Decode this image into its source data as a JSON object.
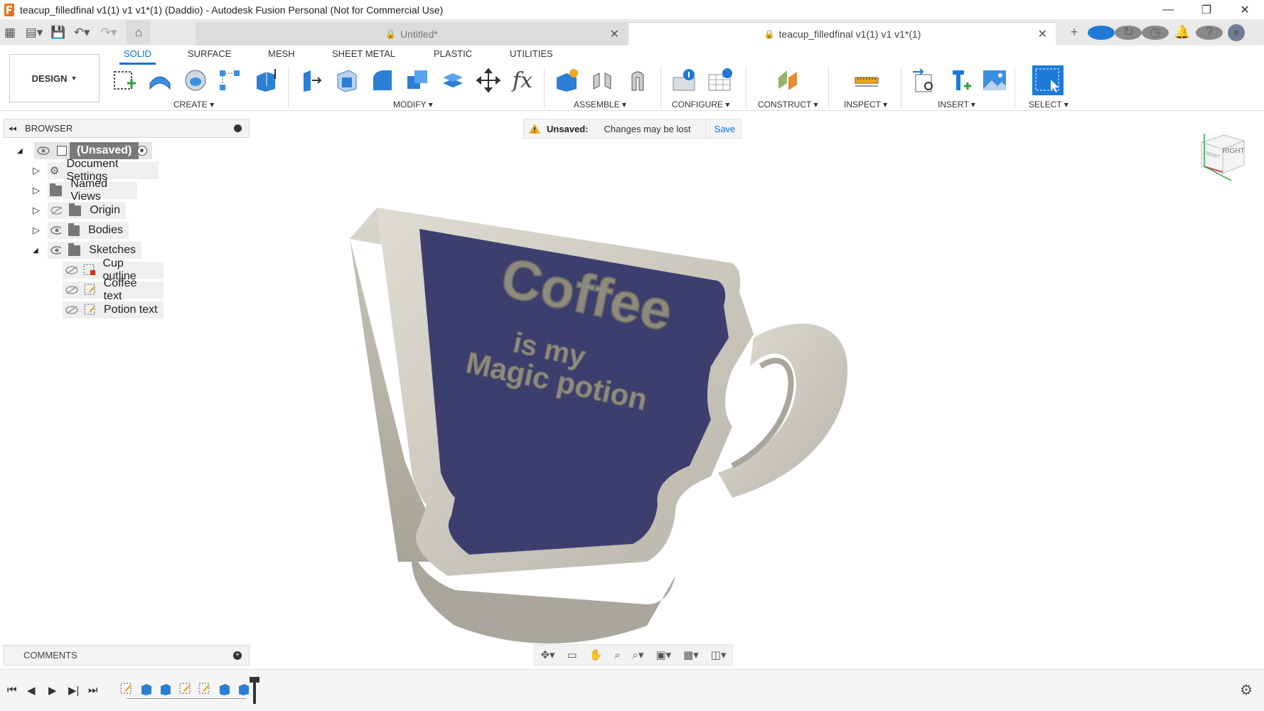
{
  "window": {
    "title": "teacup_filledfinal v1(1) v1 v1*(1) (Daddio) - Autodesk Fusion Personal (Not for Commercial Use)",
    "min": "—",
    "max": "❐",
    "close": "✕"
  },
  "tabs": {
    "untitled": "Untitled*",
    "active": "teacup_filledfinal v1(1) v1 v1*(1)",
    "close": "✕",
    "new_tab": "+"
  },
  "toolbar": {
    "workspace": "DESIGN",
    "workspace_tabs": [
      "SOLID",
      "SURFACE",
      "MESH",
      "SHEET METAL",
      "PLASTIC",
      "UTILITIES"
    ],
    "groups": [
      "CREATE",
      "MODIFY",
      "ASSEMBLE",
      "CONFIGURE",
      "CONSTRUCT",
      "INSPECT",
      "INSERT",
      "SELECT"
    ]
  },
  "browser": {
    "title": "BROWSER",
    "root": "(Unsaved)",
    "items": [
      "Document Settings",
      "Named Views",
      "Origin",
      "Bodies",
      "Sketches"
    ],
    "sketches": [
      "Cup outline",
      "Coffee text",
      "Potion text"
    ]
  },
  "banner": {
    "label": "Unsaved:",
    "message": "Changes may be lost",
    "save": "Save"
  },
  "model_text": {
    "line1": "Coffee",
    "line2": "is my",
    "line3": "Magic potion"
  },
  "viewcube": {
    "right": "RIGHT",
    "front": "FRONT"
  },
  "comments": {
    "title": "COMMENTS"
  },
  "colors": {
    "accent": "#0a6fd6",
    "cup": "#cfccc2",
    "cup_face": "#3c3f6e",
    "text": "#8d8a7f"
  }
}
